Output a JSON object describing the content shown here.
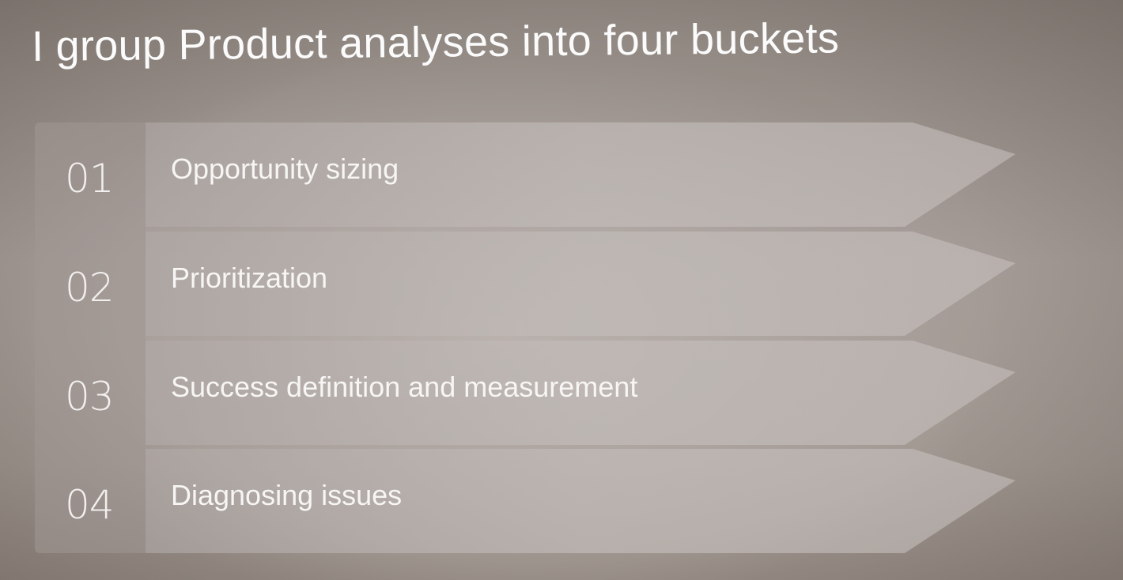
{
  "slide": {
    "title": "I group Product analyses into four buckets",
    "buckets": [
      {
        "number": "01",
        "label": "Opportunity sizing"
      },
      {
        "number": "02",
        "label": "Prioritization"
      },
      {
        "number": "03",
        "label": "Success definition and measurement"
      },
      {
        "number": "04",
        "label": "Diagnosing issues"
      }
    ]
  }
}
